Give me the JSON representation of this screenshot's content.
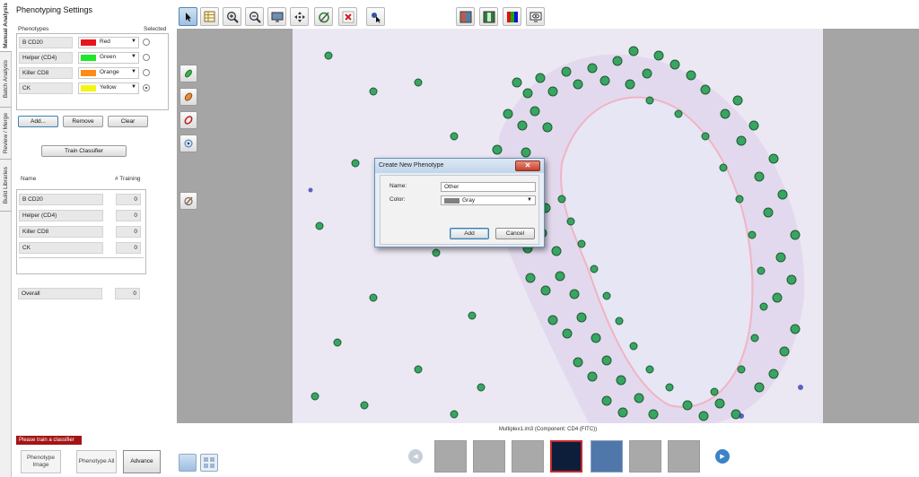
{
  "vtabs": [
    "Manual Analysis",
    "Batch Analysis",
    "Review / Merge",
    "Build Libraries"
  ],
  "panel": {
    "title": "Phenotyping Settings",
    "phenotypes_header": "Phenotypes",
    "selected_header": "Selected",
    "phenotypes": [
      {
        "name": "B CD20",
        "color_name": "Red",
        "color": "#e8141c",
        "selected": false
      },
      {
        "name": "Helper (CD4)",
        "color_name": "Green",
        "color": "#1ee82a",
        "selected": false
      },
      {
        "name": "Killer CD8",
        "color_name": "Orange",
        "color": "#ff8a14",
        "selected": false
      },
      {
        "name": "CK",
        "color_name": "Yellow",
        "color": "#f5f514",
        "selected": true
      }
    ],
    "add_label": "Add...",
    "remove_label": "Remove",
    "clear_label": "Clear",
    "train_label": "Train Classifier",
    "name_header": "Name",
    "training_header": "# Training",
    "training_rows": [
      {
        "name": "B CD20",
        "count": "0"
      },
      {
        "name": "Helper (CD4)",
        "count": "0"
      },
      {
        "name": "Killer CD8",
        "count": "0"
      },
      {
        "name": "CK",
        "count": "0"
      }
    ],
    "overall_label": "Overall",
    "overall_count": "0",
    "warning": "Please train a classifier",
    "phenotype_image_label": "Phenotype Image",
    "phenotype_all_label": "Phenotype All",
    "advance_label": "Advance"
  },
  "viewer": {
    "caption": "Multiplex1.im3  (Component: CD4 (FITC))"
  },
  "dialog": {
    "title": "Create New Phenotype",
    "name_label": "Name:",
    "name_value": "Other",
    "color_label": "Color:",
    "color_value": "Gray",
    "color_swatch": "#808080",
    "add_label": "Add",
    "cancel_label": "Cancel"
  }
}
